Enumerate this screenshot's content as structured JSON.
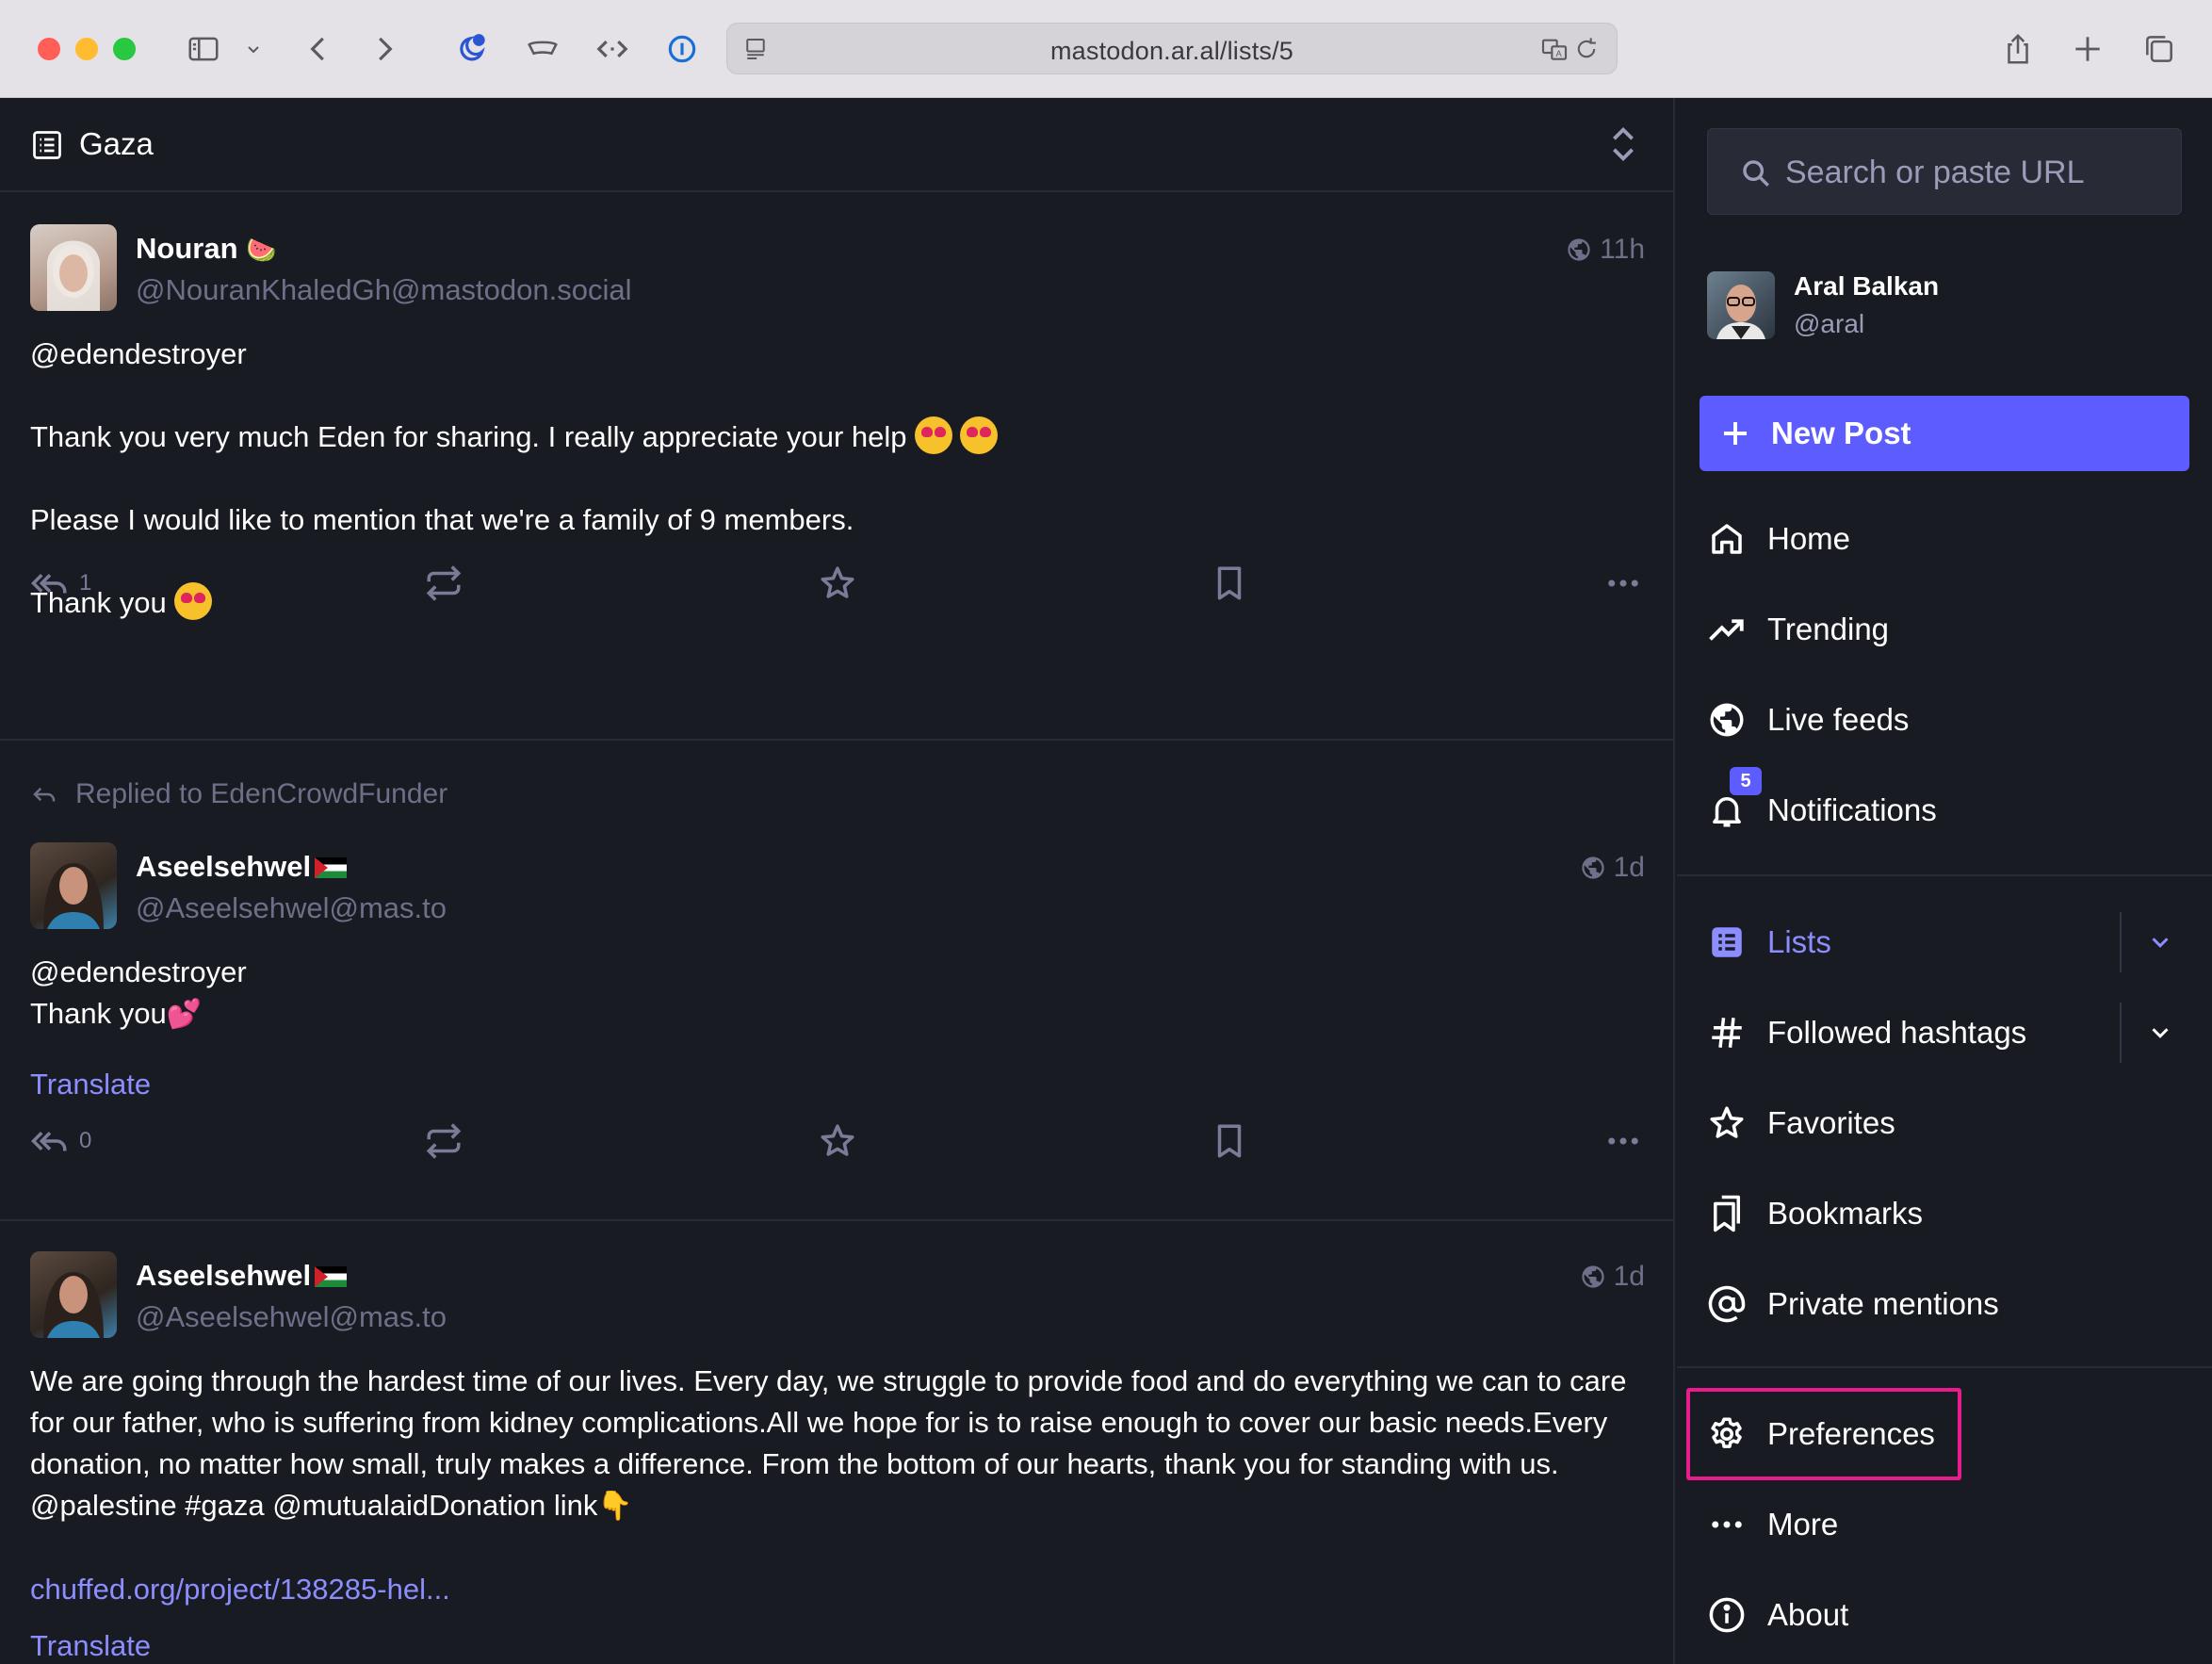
{
  "browser": {
    "url": "mastodon.ar.al/lists/5",
    "colors": {
      "close": "#ff5f57",
      "minimize": "#febc2e",
      "zoom": "#28c840"
    }
  },
  "column": {
    "title": "Gaza"
  },
  "posts": [
    {
      "display_name": "Nouran",
      "display_name_emoji": "🍉",
      "acct": "@NouranKhaledGh@mastodon.social",
      "time": "11h",
      "paragraphs": [
        "@edendestroyer",
        "Thank you very much Eden for sharing. I really appreciate your help",
        "Please I would like to mention that we're a family of 9 members.",
        "Thank you"
      ],
      "reply_count": "1"
    },
    {
      "replied_to": "Replied to EdenCrowdFunder",
      "display_name": "Aseelsehwel",
      "acct": "@Aseelsehwel@mas.to",
      "time": "1d",
      "line1": "@edendestroyer",
      "line2": "Thank you",
      "line2_emoji": "💕",
      "translate": "Translate",
      "reply_count": "0"
    },
    {
      "display_name": "Aseelsehwel",
      "acct": "@Aseelsehwel@mas.to",
      "time": "1d",
      "body": "We are going through the hardest time of our lives. Every day, we struggle to provide food and do everything we can to care for our father, who is suffering from kidney complications.All we hope for is to raise enough to cover our basic needs.Every donation, no matter how small, truly makes a difference. From the bottom of our hearts, thank you for standing with us. @palestine #gaza @mutualaidDonation link",
      "body_emoji": "👇",
      "link": "chuffed.org/project/138285-hel...",
      "translate": "Translate"
    }
  ],
  "sidebar": {
    "search_placeholder": "Search or paste URL",
    "profile": {
      "name": "Aral Balkan",
      "acct": "@aral"
    },
    "new_post": "New Post",
    "nav": [
      {
        "label": "Home",
        "icon": "home-icon"
      },
      {
        "label": "Trending",
        "icon": "trending-icon"
      },
      {
        "label": "Live feeds",
        "icon": "globe-icon"
      },
      {
        "label": "Notifications",
        "icon": "bell-icon",
        "badge": "5"
      },
      {
        "label": "Lists",
        "icon": "list-icon"
      },
      {
        "label": "Followed hashtags",
        "icon": "hashtag-icon"
      },
      {
        "label": "Favorites",
        "icon": "star-icon"
      },
      {
        "label": "Bookmarks",
        "icon": "bookmarks-icon"
      },
      {
        "label": "Private mentions",
        "icon": "at-icon"
      },
      {
        "label": "Preferences",
        "icon": "gear-icon"
      },
      {
        "label": "More",
        "icon": "ellipsis-icon"
      },
      {
        "label": "About",
        "icon": "info-icon"
      }
    ],
    "accent_color": "#5c5cff",
    "highlight_color": "#e81c8c"
  }
}
